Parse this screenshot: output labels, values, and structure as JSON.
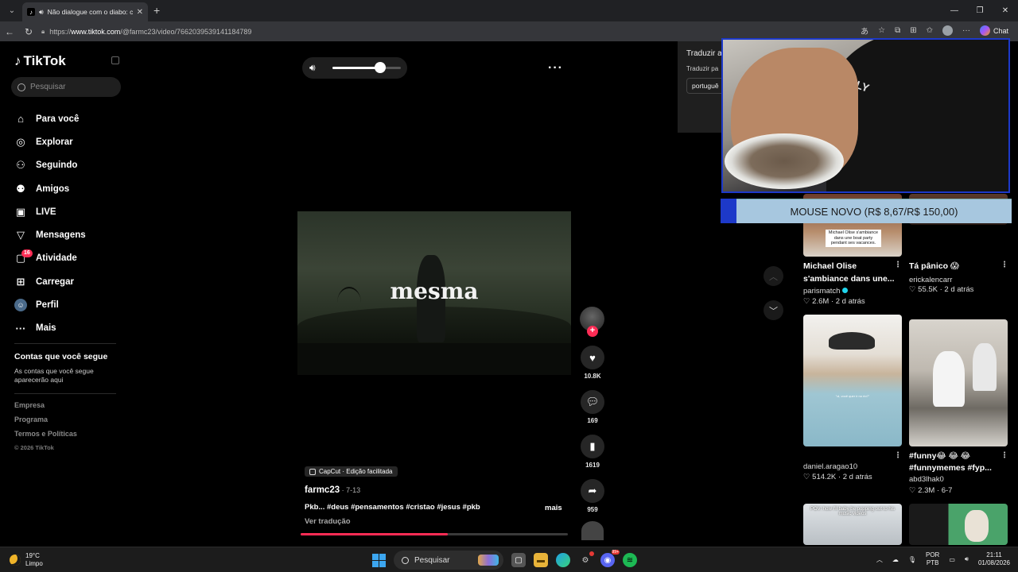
{
  "browser": {
    "tab_title": "Não dialogue com o diabo: c",
    "new_tab_icon": "plus-icon",
    "url_prefix": "https://",
    "url_host": "www.tiktok.com",
    "url_path": "/@farmc23/video/7662039539141184789",
    "chat_label": "Chat"
  },
  "sidebar": {
    "logo": "TikTok",
    "search_placeholder": "Pesquisar",
    "items": [
      {
        "label": "Para você",
        "icon": "home-icon"
      },
      {
        "label": "Explorar",
        "icon": "compass-icon"
      },
      {
        "label": "Seguindo",
        "icon": "following-icon"
      },
      {
        "label": "Amigos",
        "icon": "friends-icon"
      },
      {
        "label": "LIVE",
        "icon": "live-icon"
      },
      {
        "label": "Mensagens",
        "icon": "messages-icon"
      },
      {
        "label": "Atividade",
        "icon": "activity-icon",
        "badge": "16"
      },
      {
        "label": "Carregar",
        "icon": "upload-icon"
      },
      {
        "label": "Perfil",
        "icon": "profile-avatar"
      },
      {
        "label": "Mais",
        "icon": "more-icon"
      }
    ],
    "following_heading": "Contas que você segue",
    "following_sub": "As contas que você segue aparecerão aqui",
    "footer": [
      "Empresa",
      "Programa",
      "Termos e Políticas"
    ],
    "copyright": "© 2026 TikTok"
  },
  "video": {
    "volume_level": 0.7,
    "caption_word": "mesma",
    "capcut_label": "CapCut · Edição facilitada",
    "author": "farmc23",
    "date": " · 7-13",
    "description": "Pkb... #deus #pensamentos #cristao #jesus #pkb",
    "more_label": "mais",
    "translate_label": "Ver tradução",
    "progress": 0.55,
    "likes": "10.8K",
    "comments": "169",
    "saves": "1619",
    "shares": "959"
  },
  "translate_popup": {
    "title": "Traduzir a",
    "subtitle": "Traduzir pa",
    "language": "portuguê"
  },
  "overlay": {
    "webcam_shirt_text": "ONLY",
    "promo": "MOUSE NOVO (R$ 8,67/R$ 150,00)"
  },
  "feed": [
    {
      "title_1": "Michael Olise",
      "title_2": "s'ambiance dans une...",
      "user": "parismatch",
      "verified": true,
      "stats": "♡ 2.6M · 2 d atrás",
      "thumb_caption": "Michael Olise s'ambiance dans une boat party pendant ses vacances."
    },
    {
      "title_1": "Tá pânico 😱",
      "title_2": "",
      "user": "erickalencarr",
      "verified": false,
      "stats": "♡ 55.5K · 2 d atrás"
    },
    {
      "title_1": "",
      "title_2": "",
      "user": "daniel.aragao10",
      "verified": false,
      "stats": "♡ 514.2K · 2 d atrás",
      "thumb_caption": "\"oi, você quer ir no rio?\""
    },
    {
      "title_1": "#funny😂 😂 😂",
      "title_2": "#funnymemes #fyp...",
      "user": "abd3lhak0",
      "verified": false,
      "stats": "♡ 2.3M · 6-7"
    },
    {
      "thumb_caption": "POV: how I'll baby be popping out to his music videos"
    }
  ],
  "taskbar": {
    "temp": "19°C",
    "condition": "Limpo",
    "search": "Pesquisar",
    "lang_1": "POR",
    "lang_2": "PTB",
    "time": "21:11",
    "date": "01/08/2026",
    "notif_badge": "99+"
  },
  "colors": {
    "accent": "#fe2c55",
    "overlay_border": "#1d39c9",
    "promo_bg": "#a7c7df"
  }
}
